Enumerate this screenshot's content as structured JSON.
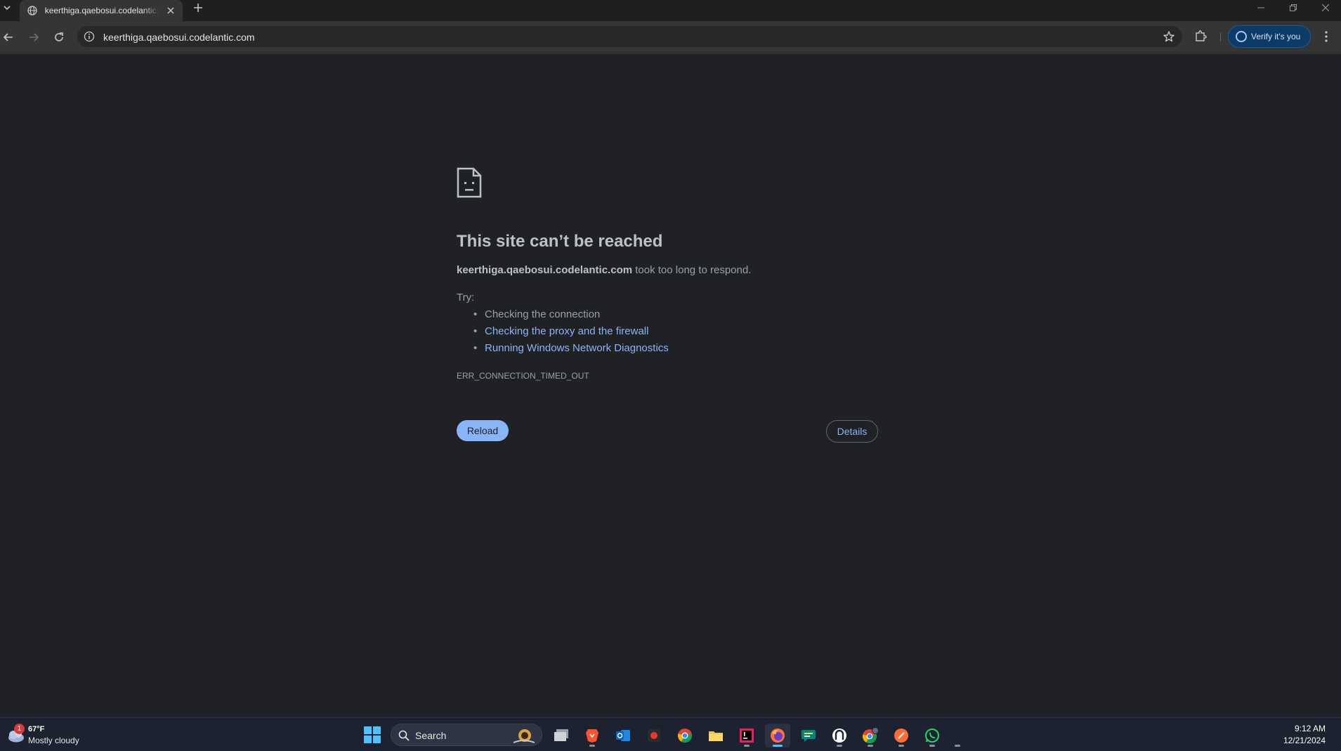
{
  "browser": {
    "tab": {
      "title": "keerthiga.qaebosui.codelantic.com"
    },
    "address_bar": {
      "url": "keerthiga.qaebosui.codelantic.com"
    },
    "profile_button": {
      "label": "Verify it's you"
    }
  },
  "error_page": {
    "title": "This site can’t be reached",
    "host": "keerthiga.qaebosui.codelantic.com",
    "message_suffix": " took too long to respond.",
    "try_label": "Try:",
    "suggestions": [
      {
        "text": "Checking the connection",
        "is_link": false
      },
      {
        "text": "Checking the proxy and the firewall",
        "is_link": true
      },
      {
        "text": "Running Windows Network Diagnostics",
        "is_link": true
      }
    ],
    "error_code": "ERR_CONNECTION_TIMED_OUT",
    "reload_label": "Reload",
    "details_label": "Details"
  },
  "taskbar": {
    "weather": {
      "temperature": "67°F",
      "condition": "Mostly cloudy",
      "badge_count": "1"
    },
    "search_label": "Search",
    "apps": [
      "file-explorer-alt",
      "brave",
      "outlook",
      "screen-recorder",
      "chrome",
      "file-explorer",
      "intellij",
      "firefox",
      "chat",
      "app-circle",
      "chrome-profile",
      "postman",
      "whatsapp"
    ],
    "clock": {
      "time": "9:12 AM",
      "date": "12/21/2024"
    }
  },
  "colors": {
    "page_bg": "#202124",
    "link": "#8ab4f8",
    "reload_bg": "#8ab4f8",
    "taskbar_bg": "#1c2230"
  }
}
